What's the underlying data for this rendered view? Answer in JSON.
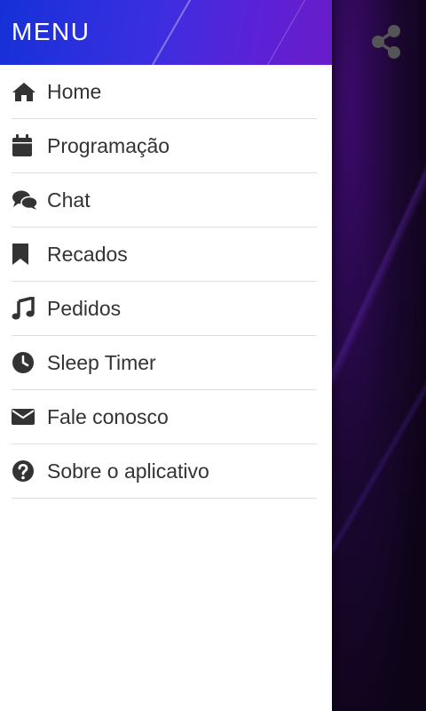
{
  "header": {
    "title": "MENU"
  },
  "menu": {
    "items": [
      {
        "label": "Home",
        "icon": "home-icon"
      },
      {
        "label": "Programação",
        "icon": "calendar-icon"
      },
      {
        "label": "Chat",
        "icon": "chat-icon"
      },
      {
        "label": "Recados",
        "icon": "bookmark-icon"
      },
      {
        "label": "Pedidos",
        "icon": "music-icon"
      },
      {
        "label": "Sleep Timer",
        "icon": "clock-icon"
      },
      {
        "label": "Fale conosco",
        "icon": "envelope-icon"
      },
      {
        "label": "Sobre o aplicativo",
        "icon": "question-icon"
      }
    ]
  },
  "toolbar": {
    "share_icon": "share-icon"
  },
  "colors": {
    "header_start": "#1530d8",
    "header_end": "#6a1cc8",
    "icon": "#333333"
  }
}
